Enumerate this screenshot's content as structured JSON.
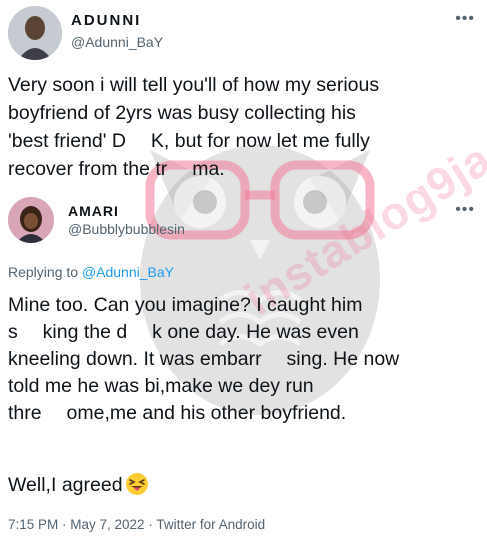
{
  "tweet": {
    "author_name": "ADUNNI",
    "author_handle": "@Adunni_BaY",
    "text_line1": "Very soon i will tell you'll of how my serious",
    "text_line2": "boyfriend of 2yrs was busy collecting his",
    "text_line3": "'best friend' D  K, but for now let me fully",
    "text_line4": "recover from the tr  ma."
  },
  "reply": {
    "author_name": "AMARI",
    "author_handle": "@Bubblybubblesin",
    "replying_prefix": "Replying to",
    "replying_handle": "@Adunni_BaY",
    "text_line1": "Mine too. Can you imagine? I caught him",
    "text_line2": "s  king the d  k one day. He was even",
    "text_line3": "kneeling down. It was embarr  sing. He now",
    "text_line4": "told me he was bi,make we dey run",
    "text_line5": "thre  ome,me and his other boyfriend.",
    "closing": "Well,I agreed",
    "timestamp": "7:15 PM · May 7, 2022 · Twitter for Android",
    "emoji": "squinting-face-with-tongue"
  },
  "watermark": {
    "text": "instablog9ja",
    "color": "#f07896"
  },
  "more_glyph": "•••"
}
